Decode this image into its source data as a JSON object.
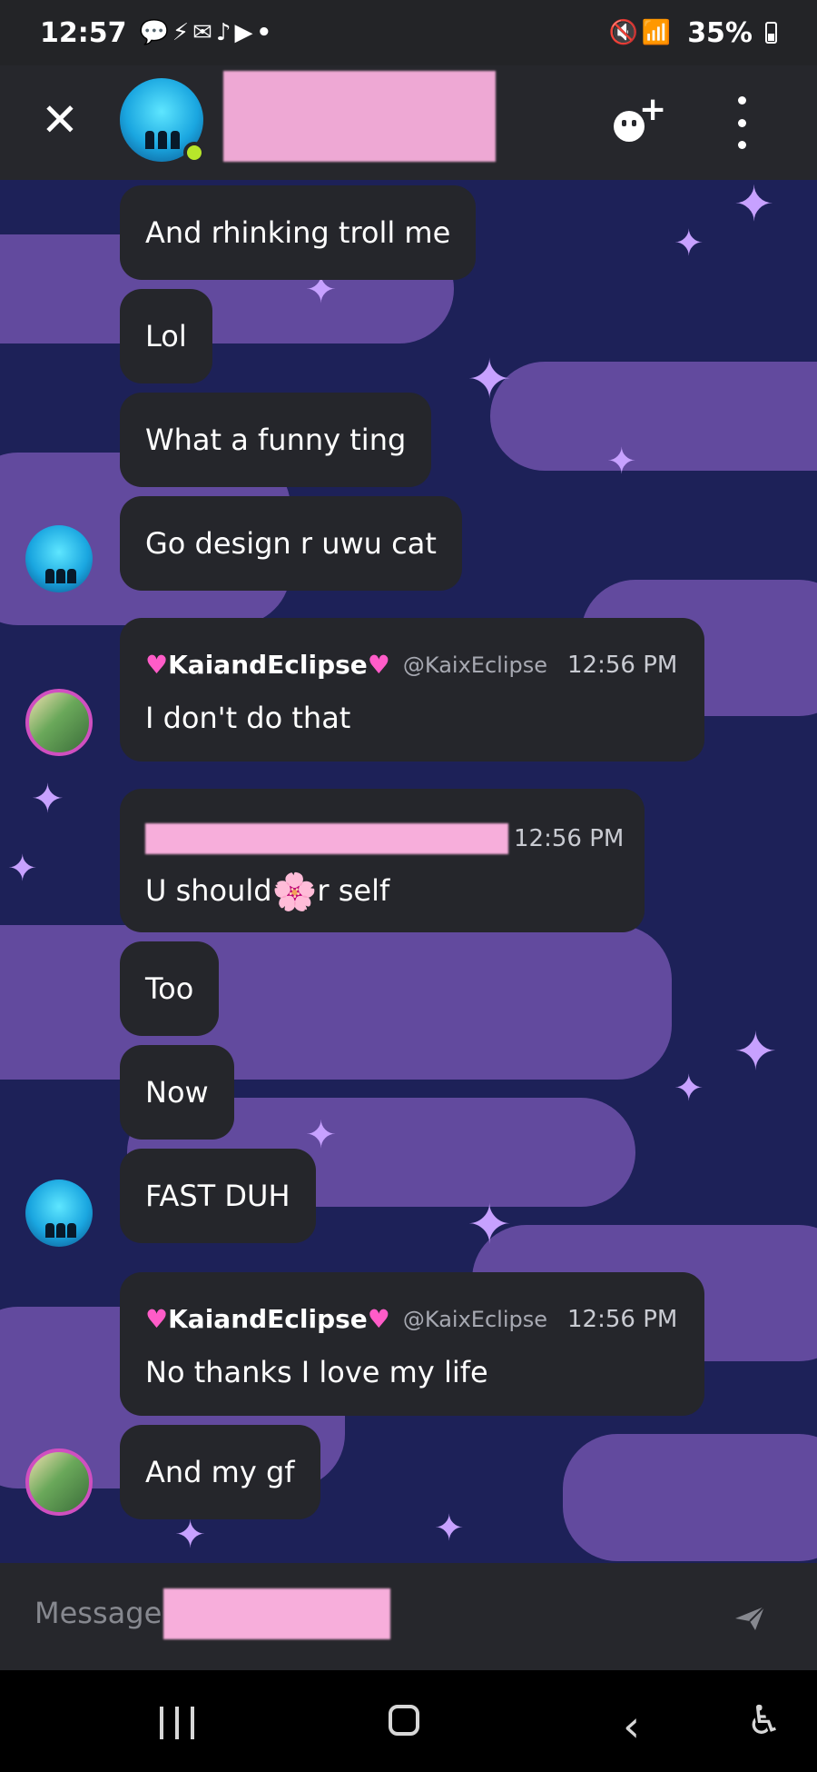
{
  "status_bar": {
    "time": "12:57",
    "notification_icons": [
      "chat-bubble-icon",
      "bolt-icon",
      "mail-icon",
      "tiktok-icon",
      "youtube-icon",
      "dot-icon"
    ],
    "right_icons": [
      "mute-icon",
      "wifi-icon",
      "signal-icon"
    ],
    "battery": "35%"
  },
  "header": {
    "online": true
  },
  "messages": [
    {
      "type": "simple",
      "text": "And rhinking troll me"
    },
    {
      "type": "simple",
      "text": "Lol"
    },
    {
      "type": "simple",
      "text": "What a funny ting"
    },
    {
      "type": "simple",
      "text": "Go design r uwu cat"
    },
    {
      "type": "rich",
      "username": "KaiandEclipse",
      "handle": "@KaixEclipse",
      "time": "12:56 PM",
      "text": "I don't do that"
    },
    {
      "type": "rich",
      "time": "12:56 PM",
      "text_before": "U should",
      "text_after": "r self"
    },
    {
      "type": "simple",
      "text": "Too"
    },
    {
      "type": "simple",
      "text": "Now"
    },
    {
      "type": "simple",
      "text": "FAST DUH"
    },
    {
      "type": "rich",
      "username": "KaiandEclipse",
      "handle": "@KaixEclipse",
      "time": "12:56 PM",
      "text": "No thanks I love my life"
    },
    {
      "type": "simple",
      "text": "And my gf"
    }
  ],
  "composer": {
    "placeholder": "Message"
  },
  "colors": {
    "bubble": "#25262b",
    "header": "#26272c",
    "background": "#1d2158",
    "online": "#b7e62a",
    "heart": "#ff5cc8",
    "redaction": "#f7aedb"
  }
}
